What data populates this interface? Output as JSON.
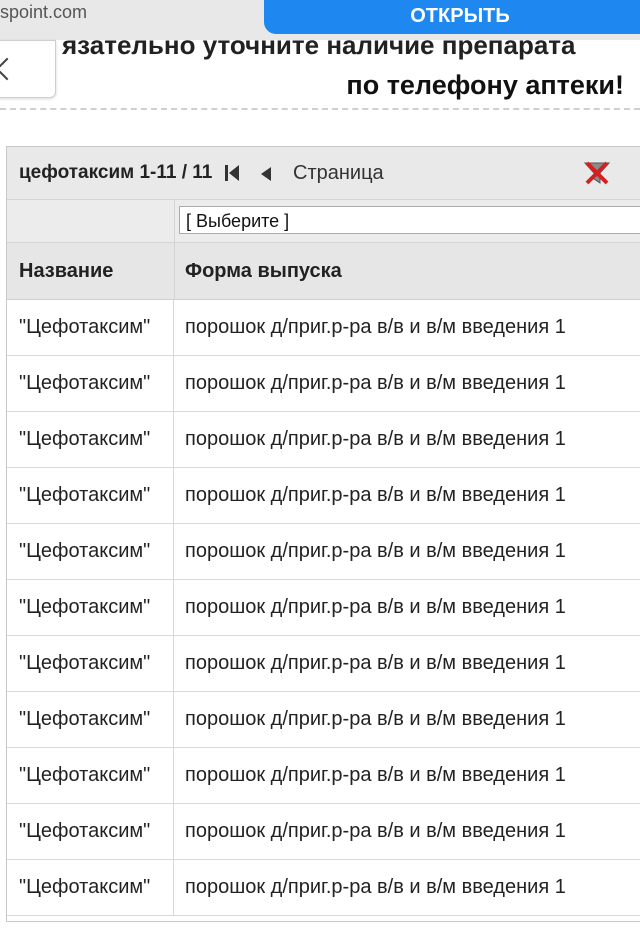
{
  "browser": {
    "domain": "spoint.com",
    "open_button": "ОТКРЫТЬ"
  },
  "notice": {
    "line1": "язательно уточните наличие препарата",
    "line2": "по телефону аптеки!"
  },
  "grid": {
    "caption": "цефотаксим 1-11 / 11",
    "page_label": "Страница",
    "filter_placeholder": "[ Выберите ]",
    "columns": [
      "Название",
      "Форма выпуска"
    ],
    "rows": [
      [
        "\"Цефотаксим\"",
        "порошок д/приг.р-ра в/в и в/м введения 1"
      ],
      [
        "\"Цефотаксим\"",
        "порошок д/приг.р-ра в/в и в/м введения 1"
      ],
      [
        "\"Цефотаксим\"",
        "порошок д/приг.р-ра в/в и в/м введения 1"
      ],
      [
        "\"Цефотаксим\"",
        "порошок д/приг.р-ра в/в и в/м введения 1"
      ],
      [
        "\"Цефотаксим\"",
        "порошок д/приг.р-ра в/в и в/м введения 1"
      ],
      [
        "\"Цефотаксим\"",
        "порошок д/приг.р-ра в/в и в/м введения 1"
      ],
      [
        "\"Цефотаксим\"",
        "порошок д/приг.р-ра в/в и в/м введения 1"
      ],
      [
        "\"Цефотаксим\"",
        "порошок д/приг.р-ра в/в и в/м введения 1"
      ],
      [
        "\"Цефотаксим\"",
        "порошок д/приг.р-ра в/в и в/м введения 1"
      ],
      [
        "\"Цефотаксим\"",
        "порошок д/приг.р-ра в/в и в/м введения 1"
      ],
      [
        "\"Цефотаксим\"",
        "порошок д/приг.р-ра в/в и в/м введения 1"
      ]
    ]
  },
  "icons": {
    "back": "chevron-left-icon",
    "first_page": "first-page-icon",
    "prev_page": "prev-page-icon",
    "clear_filter": "clear-filter-icon"
  },
  "colors": {
    "open_button": "#1e88f0",
    "grid_header": "#e6e6e6"
  }
}
